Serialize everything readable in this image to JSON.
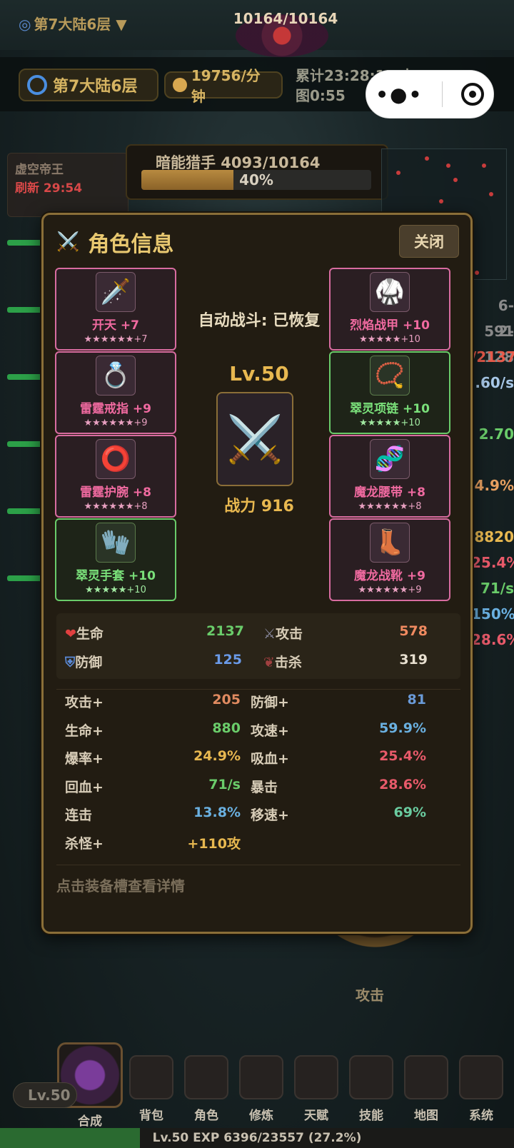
{
  "background": {
    "floor_small": "第7大陆6层 ▼",
    "boss_hp": "10164/10164",
    "floor_pill": "第7大陆6层",
    "rate": "19756/分钟",
    "total_time_line1": "累计23:28:15 本",
    "total_time_line2": "图0:55",
    "hunter_title": "暗能猎手  4093/10164",
    "hunter_pct": "40%",
    "hunter_progress": 0.4,
    "left_panel_t1": "虚空帝王",
    "left_panel_t2": "刷新 29:54",
    "attack_label": "攻击",
    "right_values": [
      "6-591",
      "2-128",
      "/2137",
      ".60/s",
      "",
      "2.70",
      "",
      "4.9%",
      "",
      "8820",
      "25.4%",
      "71/s",
      "150%",
      "28.6%"
    ]
  },
  "modal": {
    "title": "角色信息",
    "close": "关闭",
    "auto_fight": "自动战斗: 已恢复",
    "level": "Lv.50",
    "power": "战力 916",
    "hint": "点击装备槽查看详情",
    "left_slots": [
      {
        "icon": "dagger-icon",
        "glyph": "🗡️",
        "name": "开天 +7",
        "stars": "★★★★★★+7",
        "rarity": "pink"
      },
      {
        "icon": "ring-icon",
        "glyph": "💍",
        "name": "雷霆戒指 +9",
        "stars": "★★★★★★+9",
        "rarity": "pink"
      },
      {
        "icon": "bracer-icon",
        "glyph": "⭕",
        "name": "雷霆护腕 +8",
        "stars": "★★★★★★+8",
        "rarity": "pink"
      },
      {
        "icon": "gloves-icon",
        "glyph": "🧤",
        "name": "翠灵手套 +10",
        "stars": "★★★★★+10",
        "rarity": "green"
      }
    ],
    "right_slots": [
      {
        "icon": "armor-icon",
        "glyph": "🥋",
        "name": "烈焰战甲 +10",
        "stars": "★★★★★+10",
        "rarity": "pink"
      },
      {
        "icon": "necklace-icon",
        "glyph": "📿",
        "name": "翠灵项链 +10",
        "stars": "★★★★★+10",
        "rarity": "green"
      },
      {
        "icon": "belt-icon",
        "glyph": "🧬",
        "name": "魔龙腰带 +8",
        "stars": "★★★★★★+8",
        "rarity": "pink"
      },
      {
        "icon": "boots-icon",
        "glyph": "👢",
        "name": "魔龙战靴 +9",
        "stars": "★★★★★★+9",
        "rarity": "pink"
      }
    ],
    "main_stats": {
      "hp_label": "生命",
      "hp": "2137",
      "atk_label": "攻击",
      "atk": "578",
      "def_label": "防御",
      "def": "125",
      "kill_label": "击杀",
      "kill": "319"
    },
    "bonuses": [
      {
        "label": "攻击+",
        "value": "205",
        "color": "#e08a60"
      },
      {
        "label": "防御+",
        "value": "81",
        "color": "#6a9ad8"
      },
      {
        "label": "生命+",
        "value": "880",
        "color": "#6acc6a"
      },
      {
        "label": "攻速+",
        "value": "59.9%",
        "color": "#6ab0e0"
      },
      {
        "label": "爆率+",
        "value": "24.9%",
        "color": "#e8b850"
      },
      {
        "label": "吸血+",
        "value": "25.4%",
        "color": "#e85a6a"
      },
      {
        "label": "回血+",
        "value": "71/s",
        "color": "#6acc6a"
      },
      {
        "label": "暴击",
        "value": "28.6%",
        "color": "#e85a6a"
      },
      {
        "label": "连击",
        "value": "13.8%",
        "color": "#6ab0e0"
      },
      {
        "label": "移速+",
        "value": "69%",
        "color": "#6acca0"
      },
      {
        "label": "杀怪+",
        "value": "+110攻",
        "color": "#e8b850"
      }
    ]
  },
  "nav": {
    "compose": "合成",
    "items": [
      "背包",
      "角色",
      "修炼",
      "天赋",
      "技能",
      "地图",
      "系统"
    ],
    "lv_pill": "Lv.50",
    "exp_text": "Lv.50  EXP 6396/23557 (27.2%)",
    "exp_progress": 0.272
  }
}
